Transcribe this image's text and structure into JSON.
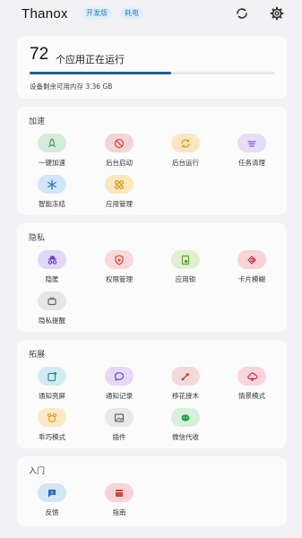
{
  "header": {
    "title": "Thanox",
    "badges": [
      "开发版",
      "耗电"
    ]
  },
  "memory": {
    "count": "72",
    "label": "个应用正在运行",
    "free_text": "设备剩余可用内存 3.36 GB",
    "usage_fraction": 0.58
  },
  "sections": {
    "speed": {
      "title": "加速",
      "items": [
        {
          "label": "一键加速",
          "icon": "rocket-icon"
        },
        {
          "label": "后台启动",
          "icon": "block-icon"
        },
        {
          "label": "后台运行",
          "icon": "sync-icon"
        },
        {
          "label": "任务清理",
          "icon": "broom-icon"
        },
        {
          "label": "智能冻结",
          "icon": "snowflake-icon"
        },
        {
          "label": "应用管理",
          "icon": "apps-grid-icon"
        }
      ]
    },
    "privacy": {
      "title": "隐私",
      "items": [
        {
          "label": "隐匿",
          "icon": "incognito-icon"
        },
        {
          "label": "权限管理",
          "icon": "shield-icon"
        },
        {
          "label": "应用锁",
          "icon": "lock-icon"
        },
        {
          "label": "卡片模糊",
          "icon": "blur-card-icon"
        },
        {
          "label": "隐私提醒",
          "icon": "alert-icon"
        }
      ]
    },
    "extend": {
      "title": "拓展",
      "items": [
        {
          "label": "通知亮屏",
          "icon": "notification-screen-icon"
        },
        {
          "label": "通知记录",
          "icon": "chat-bubble-icon"
        },
        {
          "label": "移花接木",
          "icon": "route-icon"
        },
        {
          "label": "情景模式",
          "icon": "cloud-sync-icon"
        },
        {
          "label": "乖巧模式",
          "icon": "bear-icon"
        },
        {
          "label": "插件",
          "icon": "image-plugin-icon"
        },
        {
          "label": "微信代收",
          "icon": "wechat-icon"
        }
      ]
    },
    "start": {
      "title": "入门",
      "items": [
        {
          "label": "反馈",
          "icon": "feedback-icon"
        },
        {
          "label": "指南",
          "icon": "book-icon"
        }
      ]
    }
  }
}
